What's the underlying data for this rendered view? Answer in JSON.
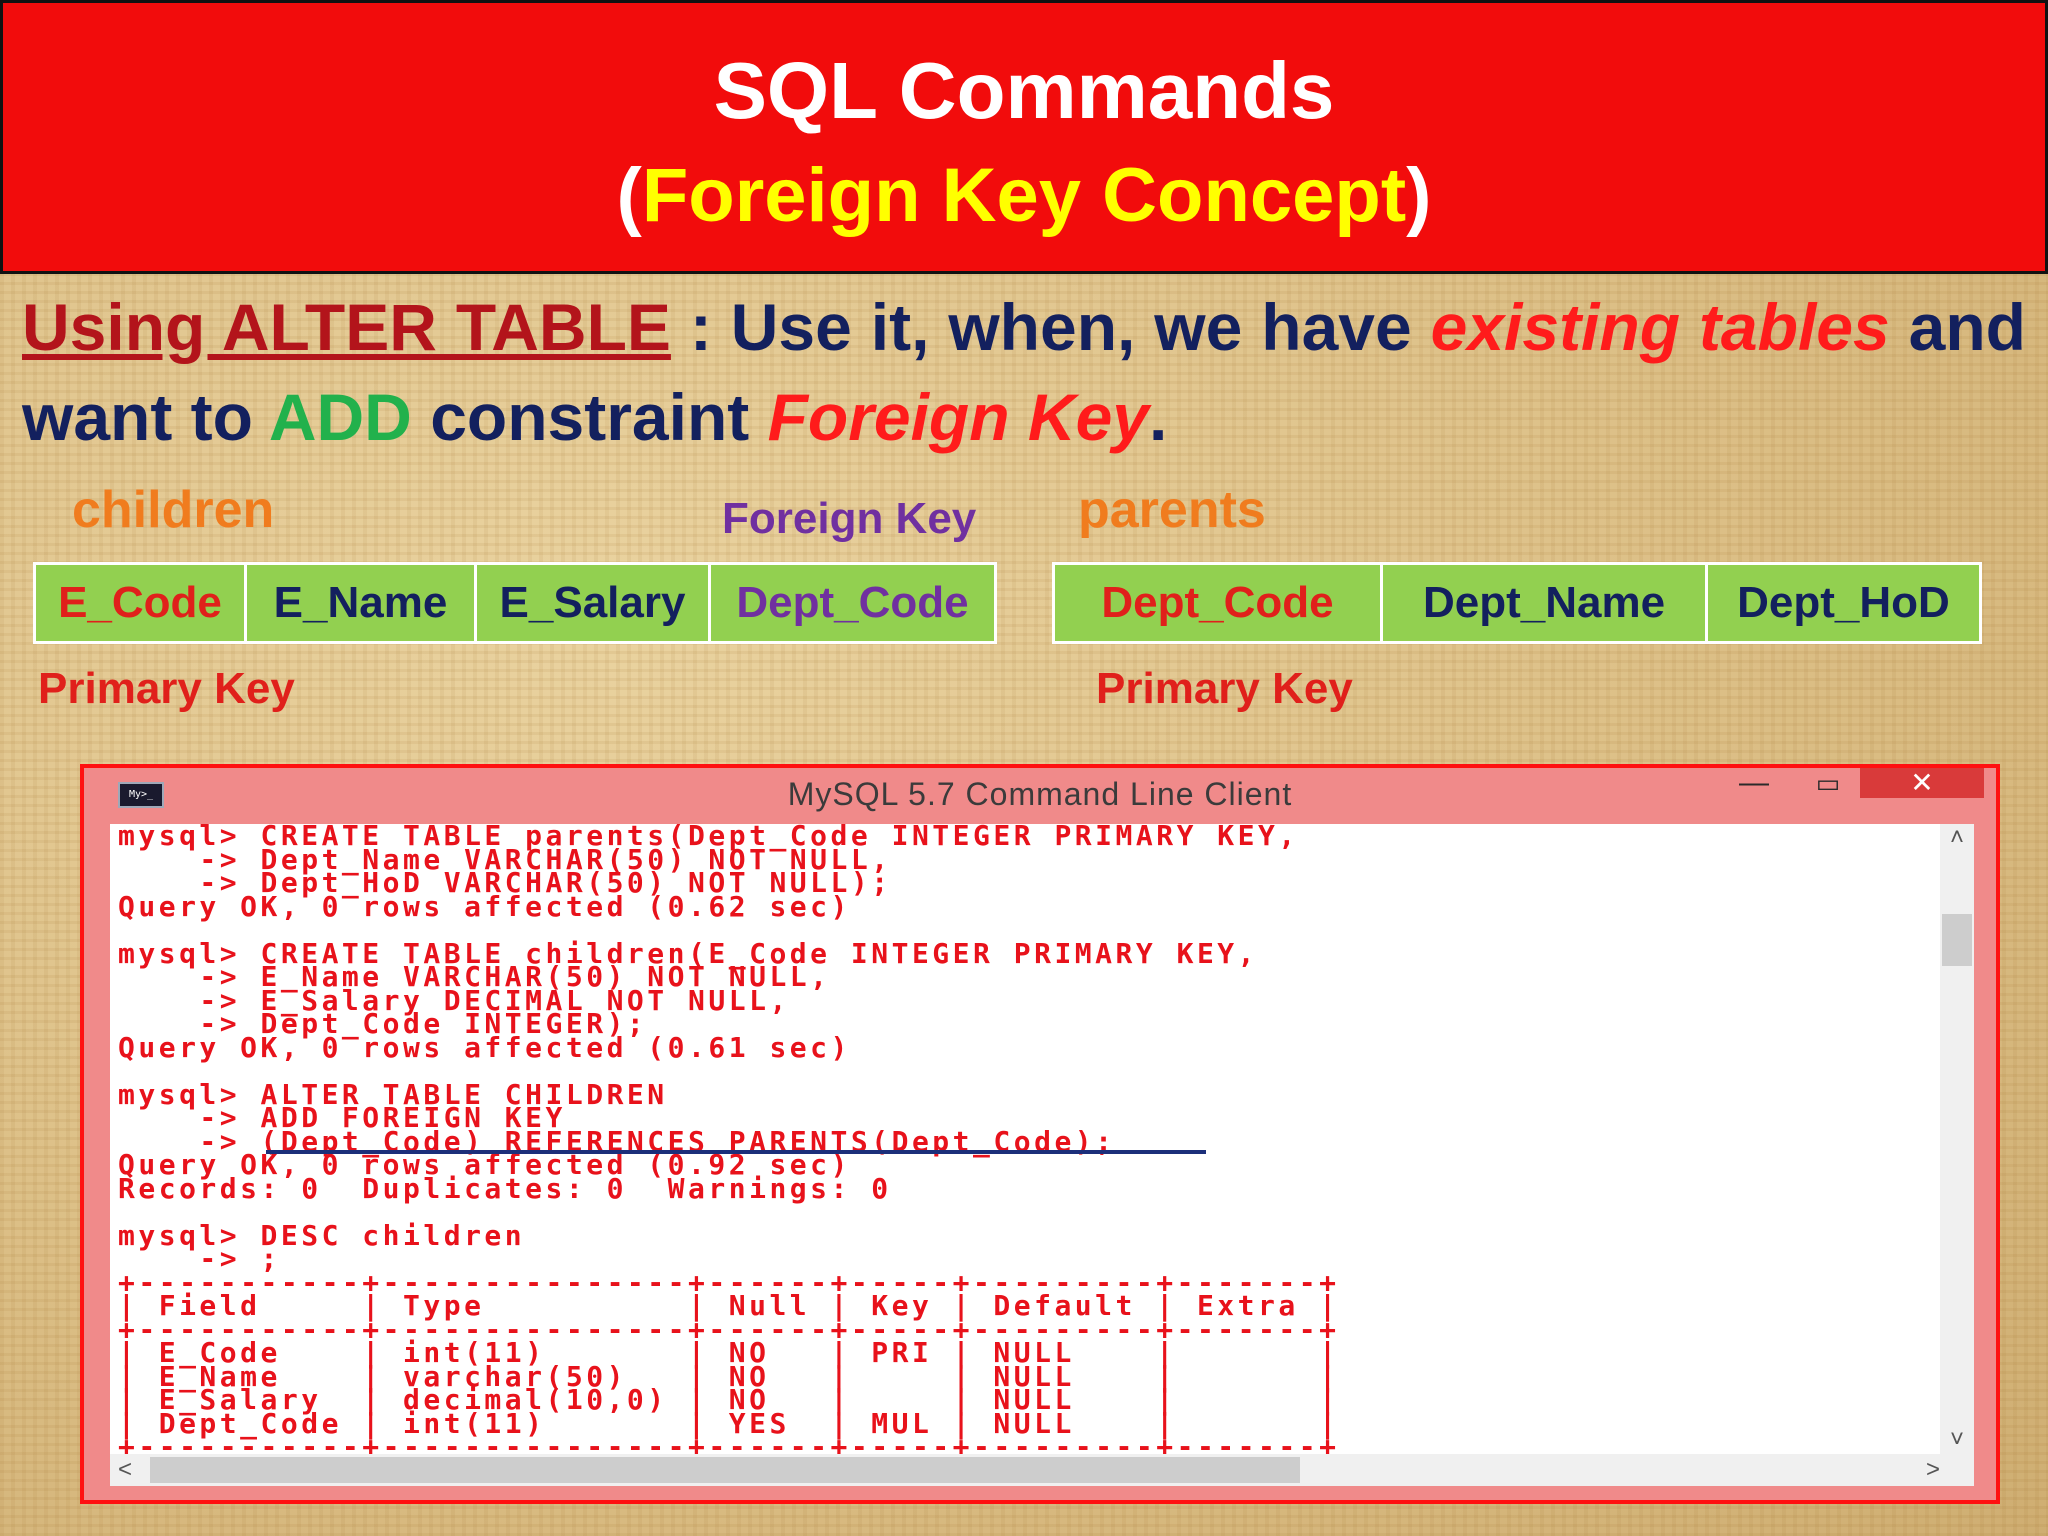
{
  "banner": {
    "title": "SQL Commands",
    "subtitle_open": "(",
    "subtitle_text": "Foreign Key Concept",
    "subtitle_close": ")"
  },
  "statement": {
    "part1": "Using ALTER TABLE",
    "part2": " : Use it, when, we have ",
    "part3": "existing tables",
    "part4": " and",
    "part5": "want to ",
    "part6": "ADD",
    "part7": " constraint ",
    "part8": "Foreign Key",
    "part9": "."
  },
  "labels": {
    "children": "children",
    "parents": "parents",
    "foreign_key": "Foreign Key",
    "primary_key_left": "Primary Key",
    "primary_key_right": "Primary Key"
  },
  "children_columns": [
    "E_Code",
    "E_Name",
    "E_Salary",
    "Dept_Code"
  ],
  "parents_columns": [
    "Dept_Code",
    "Dept_Name",
    "Dept_HoD"
  ],
  "console_window": {
    "icon_text": "My>_",
    "title": "MySQL 5.7 Command Line Client",
    "minimize": "—",
    "maximize": "▭",
    "close": "✕",
    "scroll_up": "˄",
    "scroll_down": "˅",
    "scroll_left": "<",
    "scroll_right": ">",
    "text": "mysql> CREATE TABLE parents(Dept_Code INTEGER PRIMARY KEY,\n    -> Dept_Name VARCHAR(50) NOT NULL,\n    -> Dept_HoD VARCHAR(50) NOT NULL);\nQuery OK, 0 rows affected (0.62 sec)\n\nmysql> CREATE TABLE children(E_Code INTEGER PRIMARY KEY,\n    -> E_Name VARCHAR(50) NOT NULL,\n    -> E_Salary DECIMAL NOT NULL,\n    -> Dept_Code INTEGER);\nQuery OK, 0 rows affected (0.61 sec)\n\nmysql> ALTER TABLE CHILDREN\n    -> ADD FOREIGN KEY\n    -> (Dept_Code) REFERENCES PARENTS(Dept_Code);\nQuery OK, 0 rows affected (0.92 sec)\nRecords: 0  Duplicates: 0  Warnings: 0\n\nmysql> DESC children\n    -> ;\n+-----------+---------------+------+-----+---------+-------+\n| Field     | Type          | Null | Key | Default | Extra |\n+-----------+---------------+------+-----+---------+-------+\n| E_Code    | int(11)       | NO   | PRI | NULL    |       |\n| E_Name    | varchar(50)   | NO   |     | NULL    |       |\n| E_Salary  | decimal(10,0) | NO   |     | NULL    |       |\n| Dept_Code | int(11)       | YES  | MUL | NULL    |       |\n+-----------+---------------+------+-----+---------+-------+"
  }
}
